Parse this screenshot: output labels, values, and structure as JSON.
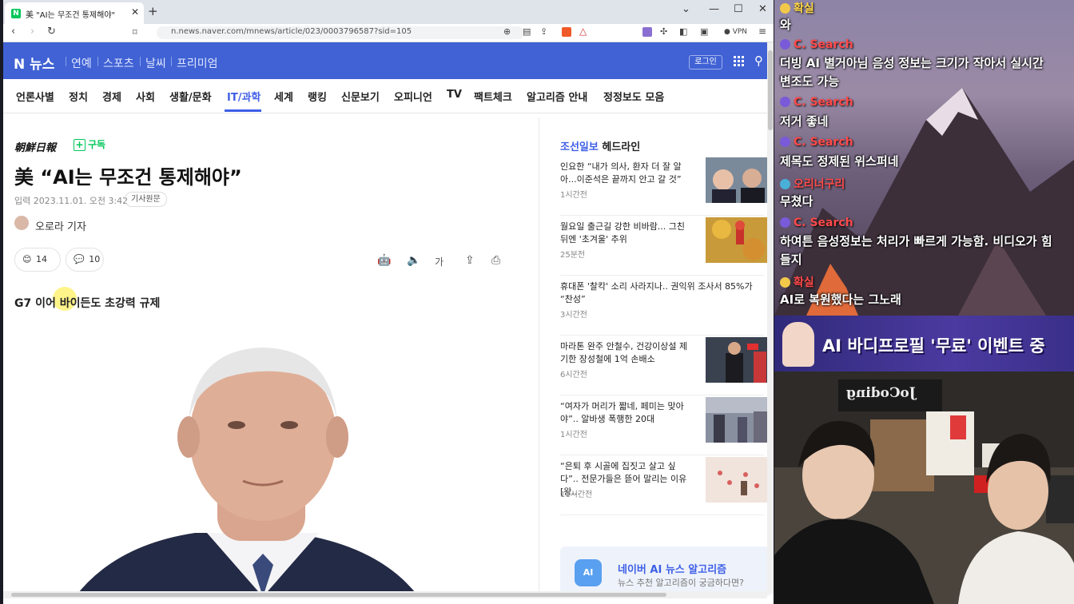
{
  "browser": {
    "tab_title": "美 \"AI는 무조건 통제해야\"",
    "url": "n.news.naver.com/mnews/article/023/0003796587?sid=105",
    "vpn": "VPN"
  },
  "naver": {
    "logo": "N 뉴스",
    "categories": [
      "연예",
      "스포츠",
      "날씨",
      "프리미엄"
    ],
    "login": "로그인"
  },
  "sections": [
    "언론사별",
    "정치",
    "경제",
    "사회",
    "생활/문화",
    "IT/과학",
    "세계",
    "랭킹",
    "신문보기",
    "오피니언",
    "TV",
    "팩트체크",
    "알고리즘 안내",
    "정정보도 모음"
  ],
  "article": {
    "brand": "朝鮮日報",
    "subscribe": "구독",
    "headline": "美 “AI는 무조건 통제해야”",
    "date": "입력 2023.11.01. 오전 3:42",
    "original_btn": "기사원문",
    "reporter": "오로라 기자",
    "reaction_count": "14",
    "comment_count": "10",
    "font_tool": "가",
    "subheadline": "G7 이어 바이든도 초강력 규제"
  },
  "sidebar": {
    "header_brand": "조선일보",
    "header_suffix": "헤드라인",
    "items": [
      {
        "title": "인요한 “내가 의사, 환자 더 잘 알아...이준석은 끝까지 안고 갈 것”",
        "time": "1시간전"
      },
      {
        "title": "월요일 출근길 강한 비바람... 그친 뒤엔 '초겨울' 추위",
        "time": "25분전"
      },
      {
        "title": "휴대폰 '찰칵' 소리 사라지나.. 권익위 조사서 85%가 “찬성”",
        "time": "3시간전"
      },
      {
        "title": "마라톤 완주 안철수, 건강이상설 제기한 장성철에 1억 손배소",
        "time": "6시간전"
      },
      {
        "title": "“여자가 머리가 짧네, 페미는 맞아야”.. 알바생 폭행한 20대",
        "time": "1시간전"
      },
      {
        "title": "“은퇴 후 시골에 집짓고 살고 싶다”.. 전문가들은 뜯어 말리는 이유 [왕...",
        "time": "11시간전"
      }
    ],
    "ai_title": "네이버 AI 뉴스 알고리즘",
    "ai_sub": "뉴스 추천 알고리즘이 궁금하다면?",
    "ai_icon": "AI"
  },
  "chat": [
    {
      "nick": "확실",
      "color": "#ffd84a"
    },
    {
      "text": "와"
    },
    {
      "nick": "C. Search",
      "color": "#ff4a4a"
    },
    {
      "text": "더빙 AI 별거아님 음성 정보는 크기가 작아서 실시간"
    },
    {
      "text": "변조도 가능"
    },
    {
      "nick": "C. Search",
      "color": "#ff4a4a"
    },
    {
      "text": "저거 좋네"
    },
    {
      "nick": "C. Search",
      "color": "#ff4a4a"
    },
    {
      "text": "제목도 정제된 위스퍼네"
    },
    {
      "nick": "오리너구리",
      "color": "#ff4a4a"
    },
    {
      "text": "무쳤다"
    },
    {
      "nick": "C. Search",
      "color": "#ff4a4a"
    },
    {
      "text": "하여튼 음성정보는 처리가 빠르게 가능함. 비디오가 힘"
    },
    {
      "text": "들지"
    },
    {
      "nick": "확실",
      "color": "#ff4a4a"
    },
    {
      "text": "AI로 복원했다는 그노래"
    }
  ],
  "banner": "AI 바디프로필 '무료' 이벤트 중",
  "cam": {
    "sign": "JoCoding"
  }
}
